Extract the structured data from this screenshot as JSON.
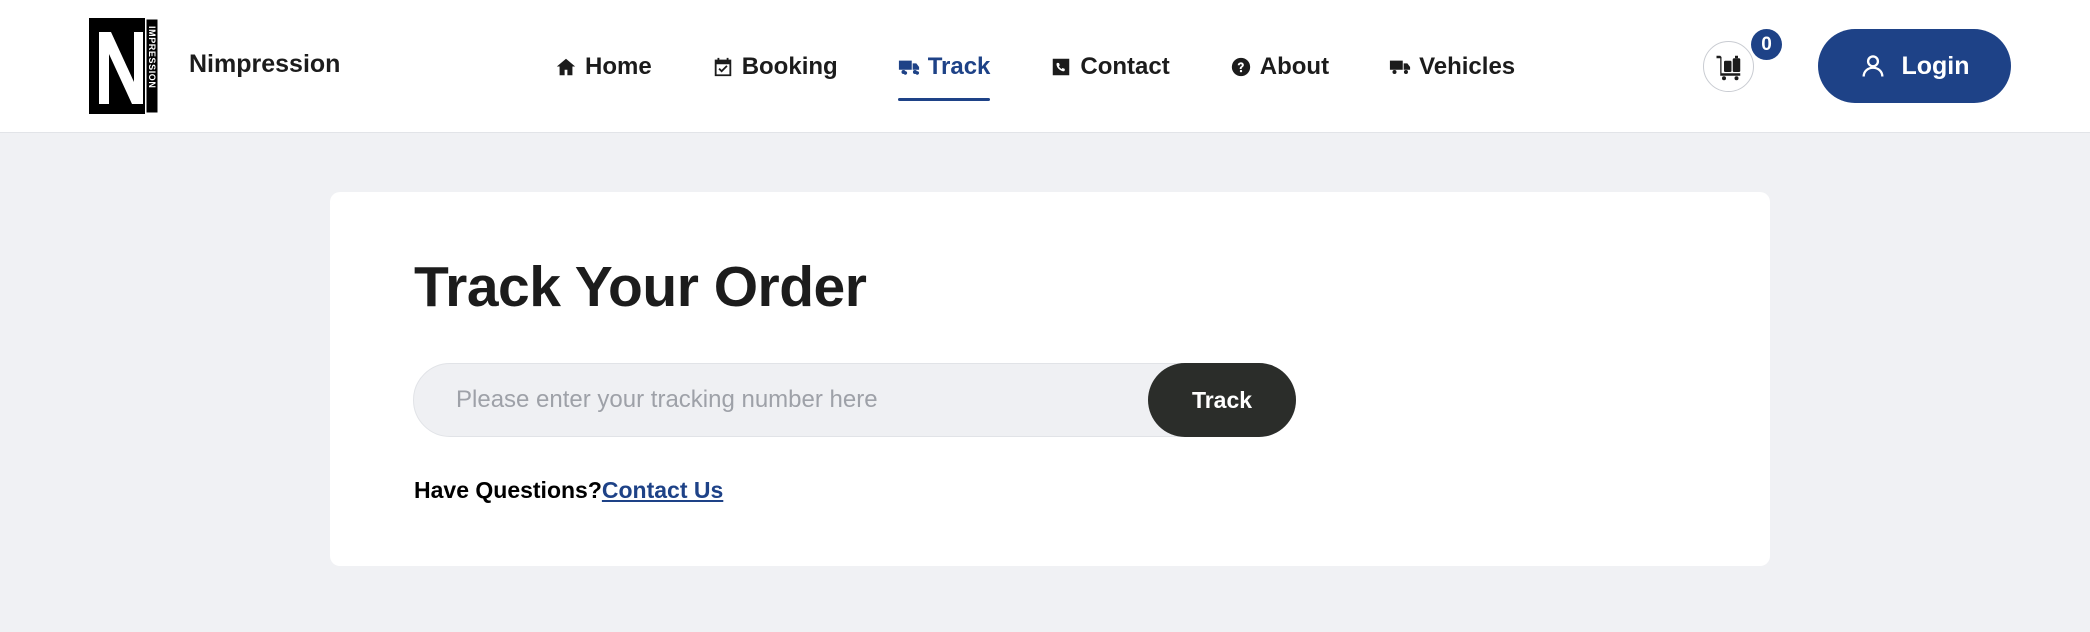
{
  "header": {
    "brand": "Nimpression",
    "logo_letter": "N",
    "logo_vertical_text": "IMPRESSION",
    "nav": [
      {
        "label": "Home",
        "icon": "home-icon",
        "active": false
      },
      {
        "label": "Booking",
        "icon": "calendar-check-icon",
        "active": false
      },
      {
        "label": "Track",
        "icon": "truck-icon",
        "active": true
      },
      {
        "label": "Contact",
        "icon": "phone-icon",
        "active": false
      },
      {
        "label": "About",
        "icon": "question-circle-icon",
        "active": false
      },
      {
        "label": "Vehicles",
        "icon": "truck-icon",
        "active": false
      }
    ],
    "cart_count": "0",
    "login_label": "Login"
  },
  "main": {
    "title": "Track Your Order",
    "input_placeholder": "Please enter your tracking number here",
    "input_value": "",
    "track_button": "Track",
    "questions_text": "Have Questions?",
    "contact_link": "Contact Us"
  },
  "colors": {
    "accent": "#1e4287",
    "button_dark": "#2b2d2a",
    "page_bg": "#f0f1f4",
    "card_bg": "#ffffff"
  }
}
